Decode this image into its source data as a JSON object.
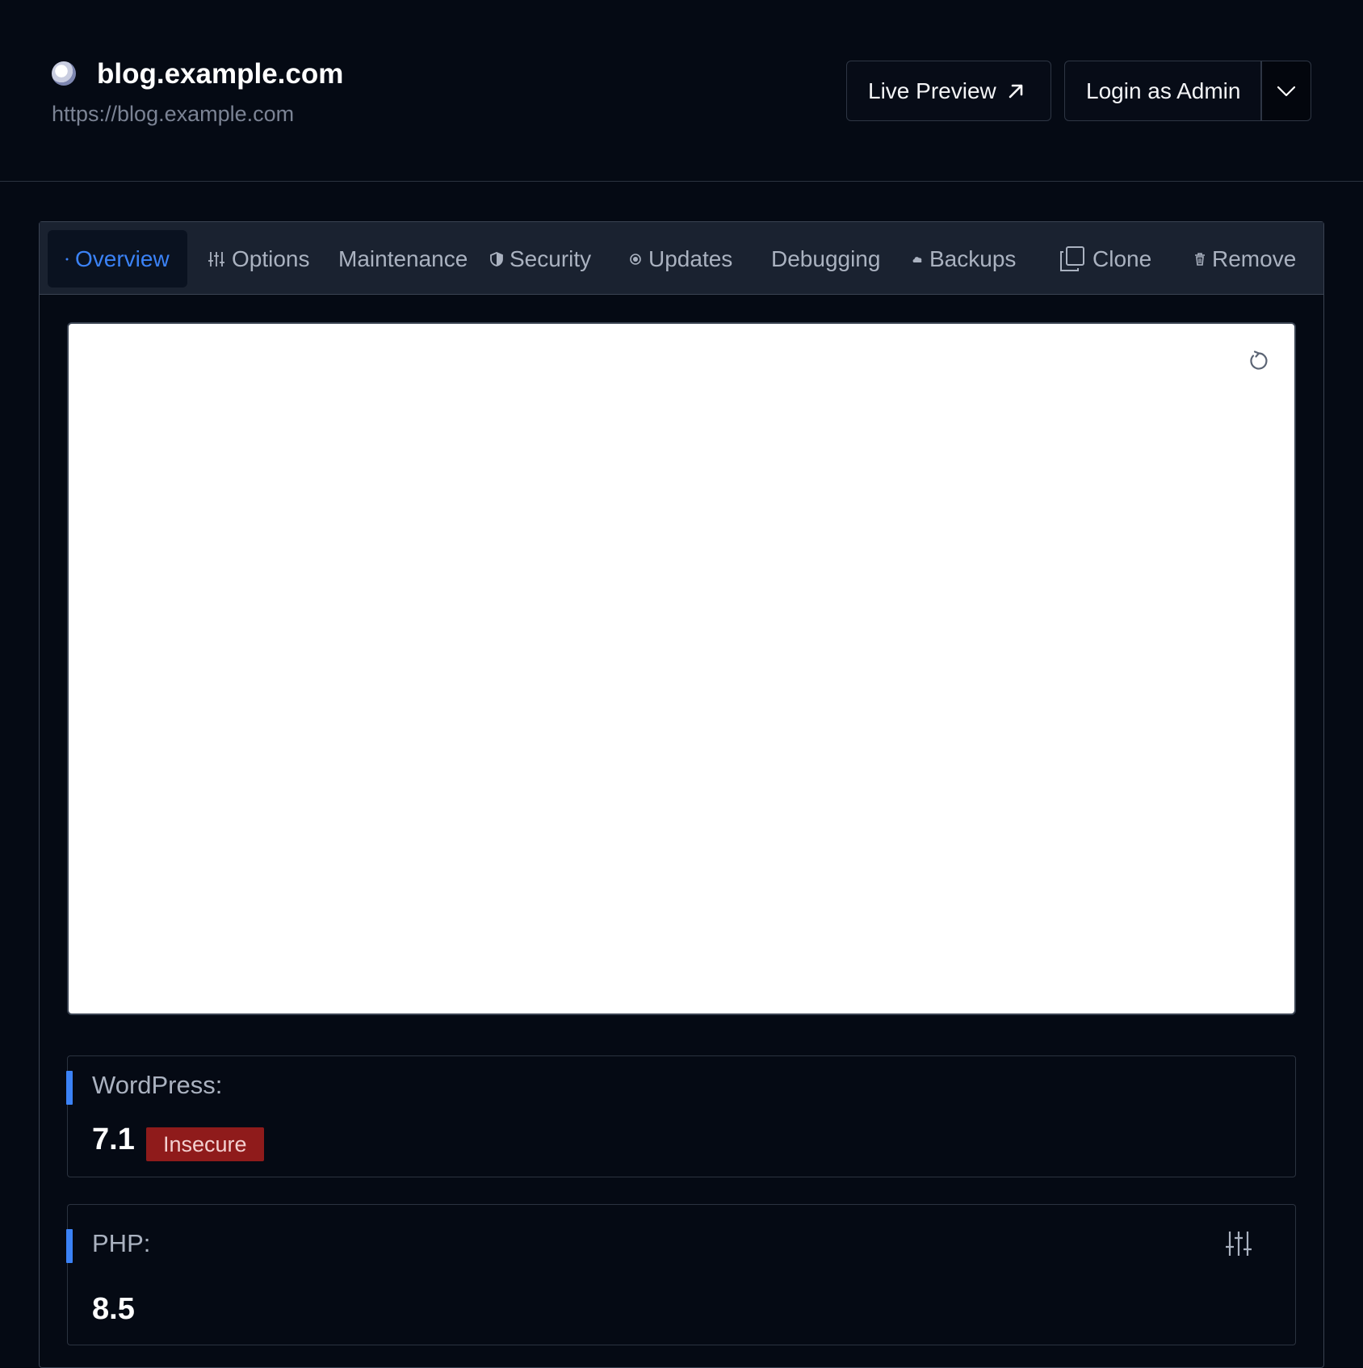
{
  "header": {
    "site_title": "blog.example.com",
    "site_url": "https://blog.example.com",
    "live_preview_label": "Live Preview",
    "login_label": "Login as Admin"
  },
  "tabs": [
    {
      "label": "Overview",
      "icon": "dot-icon",
      "active": true
    },
    {
      "label": "Options",
      "icon": "sliders-icon"
    },
    {
      "label": "Maintenance",
      "icon": ""
    },
    {
      "label": "Security",
      "icon": "shield-icon"
    },
    {
      "label": "Updates",
      "icon": "update-icon"
    },
    {
      "label": "Debugging",
      "icon": ""
    },
    {
      "label": "Backups",
      "icon": "cloud-icon"
    },
    {
      "label": "Clone",
      "icon": "copy-icon"
    },
    {
      "label": "Remove",
      "icon": "trash-icon"
    }
  ],
  "info": {
    "wordpress": {
      "label": "WordPress:",
      "value": "7.1",
      "badge": "Insecure"
    },
    "php": {
      "label": "PHP:",
      "value": "8.5"
    }
  },
  "colors": {
    "accent": "#3b82f6",
    "danger": "#8f1b1b",
    "background": "#050a14"
  }
}
